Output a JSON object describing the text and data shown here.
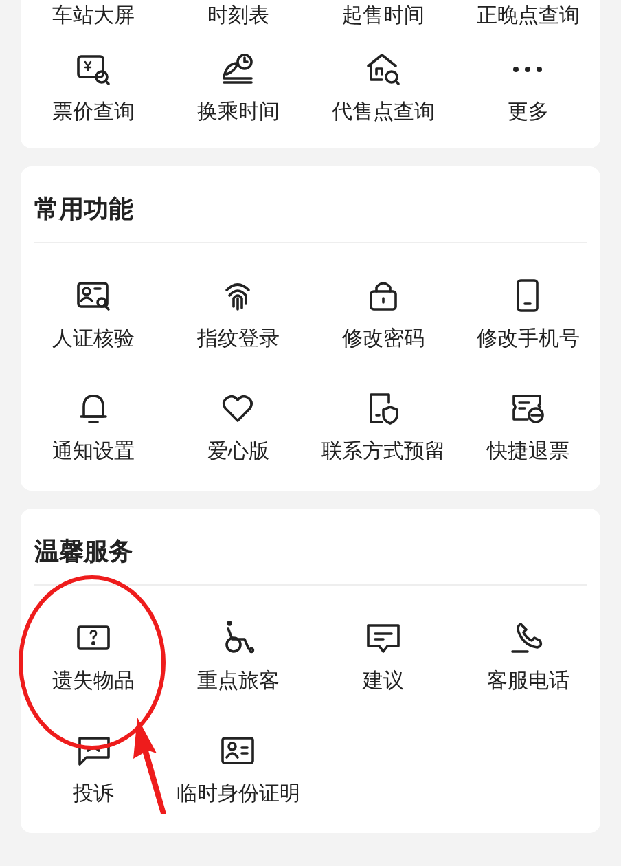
{
  "top_card": {
    "cut_row": [
      "车站大屏",
      "时刻表",
      "起售时间",
      "正晚点查询"
    ],
    "items": [
      "票价查询",
      "换乘时间",
      "代售点查询",
      "更多"
    ]
  },
  "sections": [
    {
      "title": "常用功能",
      "items": [
        "人证核验",
        "指纹登录",
        "修改密码",
        "修改手机号",
        "通知设置",
        "爱心版",
        "联系方式预留",
        "快捷退票"
      ]
    },
    {
      "title": "温馨服务",
      "items": [
        "遗失物品",
        "重点旅客",
        "建议",
        "客服电话",
        "投诉",
        "临时身份证明"
      ]
    }
  ]
}
